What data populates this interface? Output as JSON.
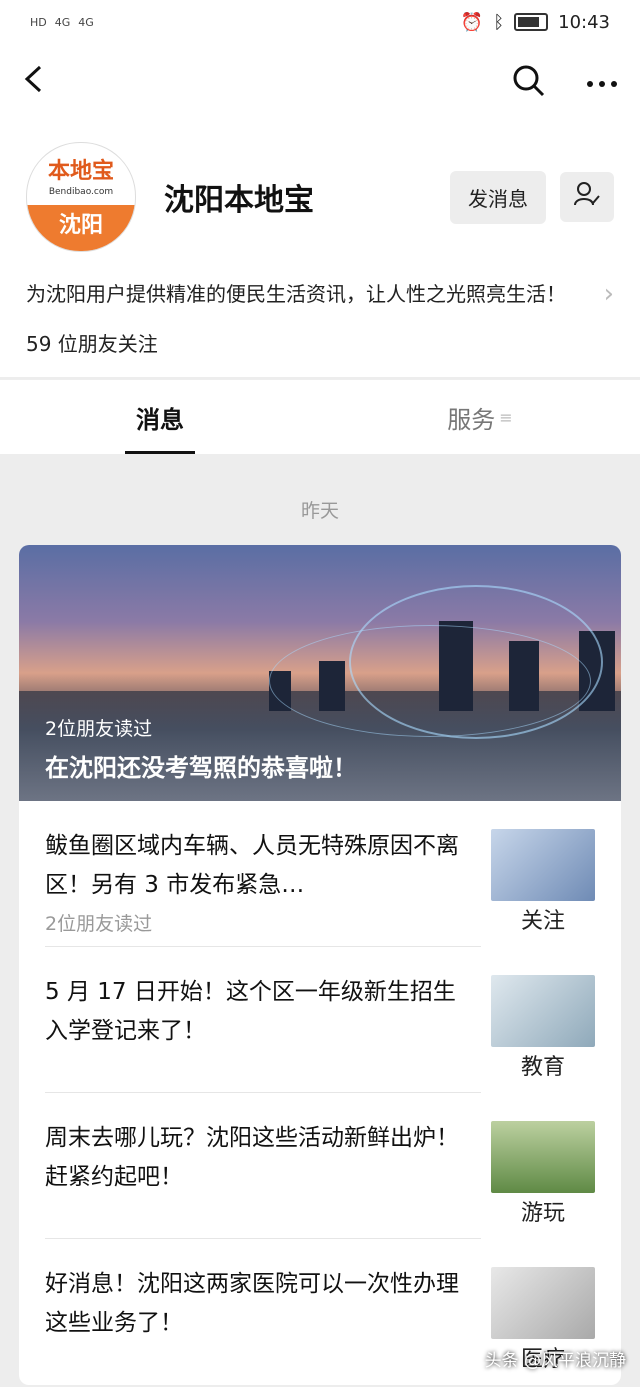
{
  "status": {
    "left": [
      "HD",
      "4G",
      "4G"
    ],
    "time": "10:43"
  },
  "nav": {
    "back_icon": "back-arrow-icon",
    "search_icon": "search-icon",
    "more_icon": "more-icon"
  },
  "profile": {
    "logo_top": "本地宝",
    "logo_mid": "Bendibao.com",
    "logo_bottom": "沈阳",
    "name": "沈阳本地宝",
    "message_btn": "发消息",
    "follow_icon": "user-check-icon",
    "description": "为沈阳用户提供精准的便民生活资讯，让人性之光照亮生活！",
    "friends": "59 位朋友关注"
  },
  "tabs": [
    {
      "label": "消息"
    },
    {
      "label": "服务"
    }
  ],
  "feed": {
    "date": "昨天",
    "hero": {
      "readers": "2位朋友读过",
      "title": "在沈阳还没考驾照的恭喜啦！"
    },
    "items": [
      {
        "title": "鲅鱼圈区域内车辆、人员无特殊原因不离区！另有 3 市发布紧急…",
        "readers": "2位朋友读过",
        "thumb_label": "关注",
        "thumb_color": "#8aa3c8"
      },
      {
        "title": "5 月 17 日开始！这个区一年级新生招生入学登记来了！",
        "readers": "",
        "thumb_label": "教育",
        "thumb_color": "#9bb6c9"
      },
      {
        "title": "周末去哪儿玩？沈阳这些活动新鲜出炉！赶紧约起吧！",
        "readers": "",
        "thumb_label": "游玩",
        "thumb_color": "#7ea46a"
      },
      {
        "title": "好消息！沈阳这两家医院可以一次性办理这些业务了！",
        "readers": "",
        "thumb_label": "医疗",
        "thumb_color": "#b9b9b9"
      }
    ]
  },
  "watermark": "头条 @风平浪沉静"
}
